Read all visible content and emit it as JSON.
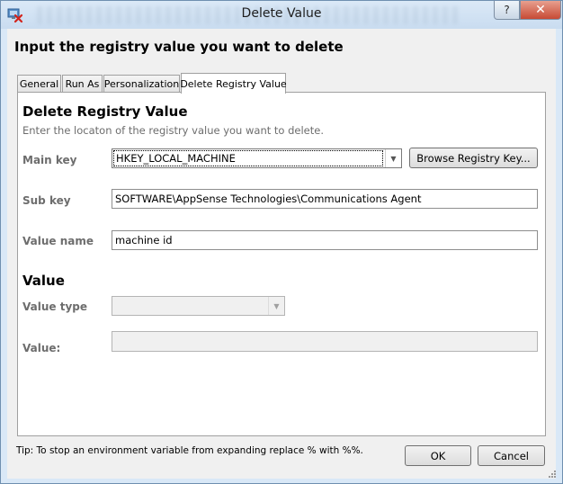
{
  "window": {
    "title": "Delete Value",
    "help_label": "?",
    "close_label": "✕",
    "app_icon": "registry-delete-icon"
  },
  "dialog": {
    "heading": "Input the registry value you want to delete"
  },
  "tabs": [
    {
      "label": "General",
      "active": false
    },
    {
      "label": "Run As",
      "active": false
    },
    {
      "label": "Personalization",
      "active": false
    },
    {
      "label": "Delete Registry Value",
      "active": true
    }
  ],
  "section": {
    "title": "Delete Registry Value",
    "description": "Enter the locaton of the registry value you want to delete."
  },
  "fields": {
    "main_key_label": "Main key",
    "main_key_value": "HKEY_LOCAL_MACHINE",
    "browse_label": "Browse Registry Key...",
    "sub_key_label": "Sub key",
    "sub_key_value": "SOFTWARE\\AppSense Technologies\\Communications Agent",
    "value_name_label": "Value name",
    "value_name_value": "machine id"
  },
  "value_section": {
    "title": "Value",
    "value_type_label": "Value type",
    "value_type_value": "",
    "value_label": "Value:",
    "value_value": ""
  },
  "footer": {
    "tip": "Tip: To stop an environment variable from expanding replace % with %%.",
    "ok_label": "OK",
    "cancel_label": "Cancel"
  },
  "colors": {
    "label_gray": "#6d6d6d",
    "close_red": "#c74a35",
    "frame_blue": "#d9e8f7"
  }
}
